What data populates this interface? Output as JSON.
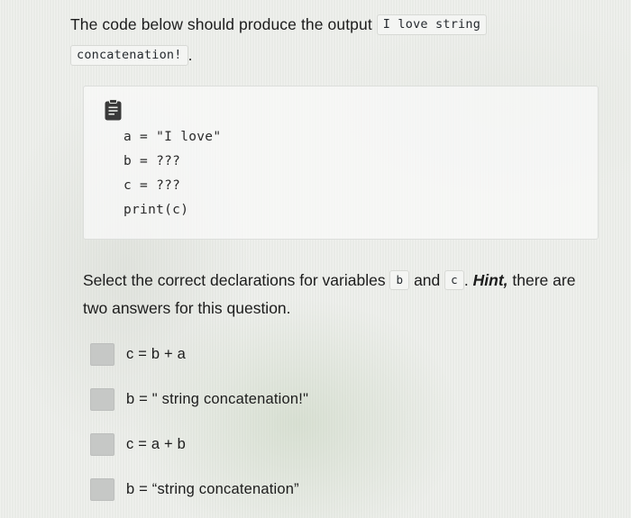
{
  "prompt": {
    "text_before": "The code below should produce the output",
    "output_code_1": "I love string",
    "output_code_2": "concatenation!",
    "text_after": "."
  },
  "code_card": {
    "icon": "clipboard-icon",
    "code": "a = \"I love\"\nb = ???\nc = ???\nprint(c)"
  },
  "question": {
    "text_before": "Select the correct declarations for variables",
    "var_b": "b",
    "text_and": "and",
    "var_c": "c",
    "text_period": ".",
    "hint_label": "Hint,",
    "text_after": "there are two answers for this question."
  },
  "options": [
    {
      "label": "c = b + a"
    },
    {
      "label": "b = \" string concatenation!\""
    },
    {
      "label": "c = a + b"
    },
    {
      "label": "b = “string concatenation”"
    }
  ]
}
